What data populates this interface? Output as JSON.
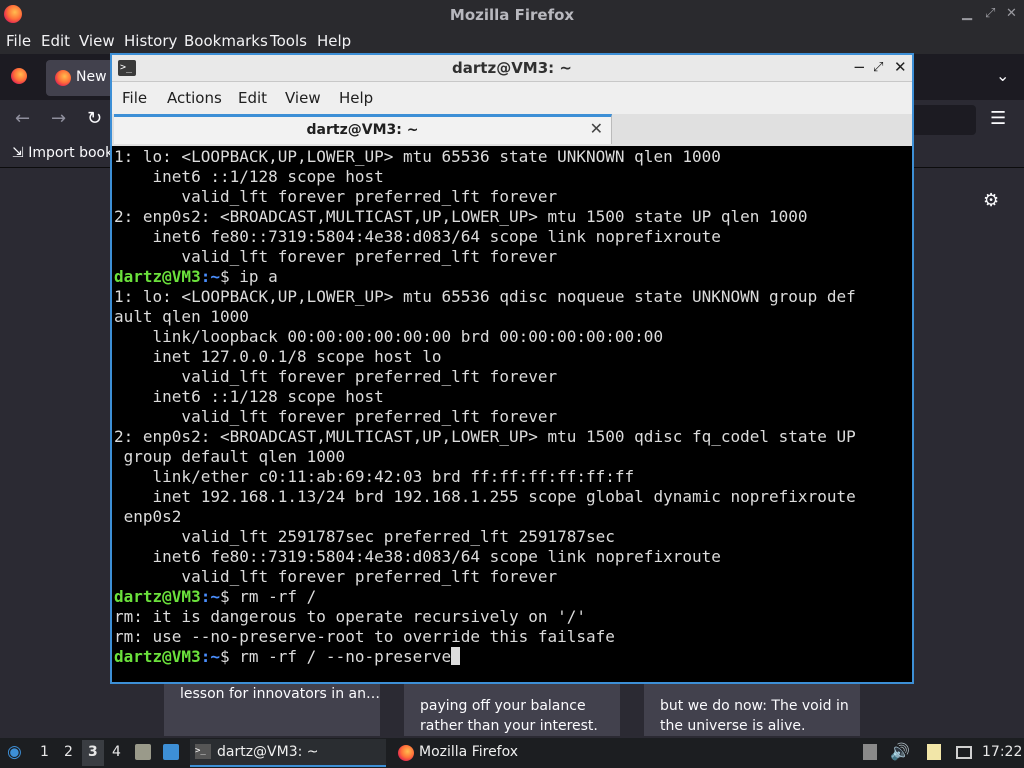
{
  "firefox": {
    "title": "Mozilla Firefox",
    "menu": [
      "File",
      "Edit",
      "View",
      "History",
      "Bookmarks",
      "Tools",
      "Help"
    ],
    "tab_label": "New",
    "bookmarks_import": "Import book",
    "cards": [
      {
        "text": "lesson for innovators in an…"
      },
      {
        "text": "paying off your balance rather than your interest."
      },
      {
        "text": "but we do now: The void in the universe is alive."
      }
    ]
  },
  "terminal": {
    "window_title": "dartz@VM3: ~",
    "menu": [
      "File",
      "Actions",
      "Edit",
      "View",
      "Help"
    ],
    "tab_title": "dartz@VM3: ~",
    "prompt_user": "dartz@VM3",
    "prompt_path": ":~",
    "lines": [
      {
        "text": "1: lo: <LOOPBACK,UP,LOWER_UP> mtu 65536 state UNKNOWN qlen 1000"
      },
      {
        "text": "    inet6 ::1/128 scope host"
      },
      {
        "text": "       valid_lft forever preferred_lft forever"
      },
      {
        "text": "2: enp0s2: <BROADCAST,MULTICAST,UP,LOWER_UP> mtu 1500 state UP qlen 1000"
      },
      {
        "text": "    inet6 fe80::7319:5804:4e38:d083/64 scope link noprefixroute"
      },
      {
        "text": "       valid_lft forever preferred_lft forever"
      },
      {
        "prompt": true,
        "text": "$ ip a"
      },
      {
        "text": "1: lo: <LOOPBACK,UP,LOWER_UP> mtu 65536 qdisc noqueue state UNKNOWN group def"
      },
      {
        "text": "ault qlen 1000"
      },
      {
        "text": "    link/loopback 00:00:00:00:00:00 brd 00:00:00:00:00:00"
      },
      {
        "text": "    inet 127.0.0.1/8 scope host lo"
      },
      {
        "text": "       valid_lft forever preferred_lft forever"
      },
      {
        "text": "    inet6 ::1/128 scope host"
      },
      {
        "text": "       valid_lft forever preferred_lft forever"
      },
      {
        "text": "2: enp0s2: <BROADCAST,MULTICAST,UP,LOWER_UP> mtu 1500 qdisc fq_codel state UP"
      },
      {
        "text": " group default qlen 1000"
      },
      {
        "text": "    link/ether c0:11:ab:69:42:03 brd ff:ff:ff:ff:ff:ff"
      },
      {
        "text": "    inet 192.168.1.13/24 brd 192.168.1.255 scope global dynamic noprefixroute"
      },
      {
        "text": " enp0s2"
      },
      {
        "text": "       valid_lft 2591787sec preferred_lft 2591787sec"
      },
      {
        "text": "    inet6 fe80::7319:5804:4e38:d083/64 scope link noprefixroute"
      },
      {
        "text": "       valid_lft forever preferred_lft forever"
      },
      {
        "prompt": true,
        "text": "$ rm -rf /"
      },
      {
        "text": "rm: it is dangerous to operate recursively on '/'"
      },
      {
        "text": "rm: use --no-preserve-root to override this failsafe"
      },
      {
        "prompt": true,
        "text": "$ rm -rf / --no-preserve",
        "cursor": true
      }
    ]
  },
  "taskbar": {
    "workspaces": [
      "1",
      "2",
      "3",
      "4"
    ],
    "active_workspace": "3",
    "terminal_task": "dartz@VM3: ~",
    "firefox_task": "Mozilla Firefox",
    "clock": "17:22"
  },
  "colors": {
    "prompt_user": "#6be13c",
    "prompt_path": "#4a8fff",
    "accent": "#3d8fd6"
  }
}
